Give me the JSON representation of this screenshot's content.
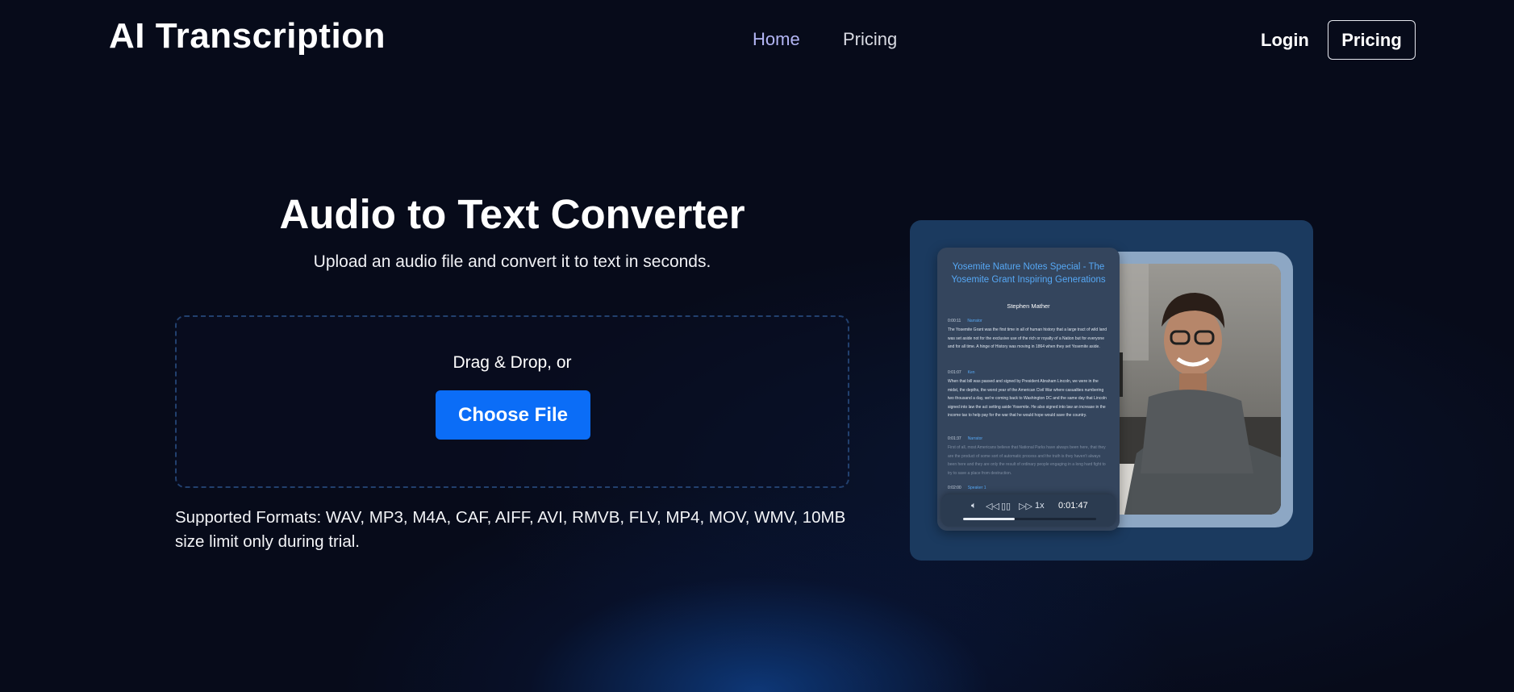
{
  "header": {
    "brand": "AI Transcription",
    "nav": [
      {
        "label": "Home"
      },
      {
        "label": "Pricing"
      }
    ],
    "login_label": "Login",
    "pricing_button_label": "Pricing"
  },
  "hero": {
    "title": "Audio to Text Converter",
    "subtitle": "Upload an audio file and convert it to text in seconds.",
    "dropzone": {
      "prompt": "Drag & Drop, or",
      "button_label": "Choose File"
    },
    "formats_note": "Supported Formats: WAV, MP3, M4A, CAF, AIFF, AVI, RMVB, FLV, MP4, MOV, WMV, 10MB size limit only during trial."
  },
  "illustration": {
    "transcript": {
      "title": "Yosemite Nature Notes Special - The Yosemite Grant Inspiring Generations",
      "author": "Stephen Mather",
      "blocks": [
        {
          "time": "0:00:11",
          "speaker": "Narrator",
          "text": "The Yosemite Grant was the first time in all of human history that a large tract of wild land was set aside not for the exclusive use of the rich or royalty of a Nation but for everyone and for all time. A hinge of History was moving in 1864 when they set Yosemite aside."
        },
        {
          "time": "0:01:07",
          "speaker": "Ken",
          "text": "When that bill was passed and signed by President Abraham Lincoln, we were in the midst, the depths, the worst year of the American Civil War where casualties numbering two thousand a day, we're coming back to Washington DC and the same day that Lincoln signed into law the act setting aside Yosemite. He also signed into law an increase in the income tax to help pay for the war that he would hope would save the country."
        },
        {
          "time": "0:01:37",
          "speaker": "Narrator",
          "text": "First of all, most Americans believe that National Parks have always been here, that they are the product of some sort of automatic process and the truth is they haven't always been here and they are only the result of ordinary people engaging in a long hard fight to try to save a place from destruction."
        },
        {
          "time": "0:02:00",
          "speaker": "Speaker 1",
          "text": ""
        }
      ]
    },
    "player": {
      "speed": "1x",
      "time": "0:01:47",
      "progress": 0.39
    }
  }
}
